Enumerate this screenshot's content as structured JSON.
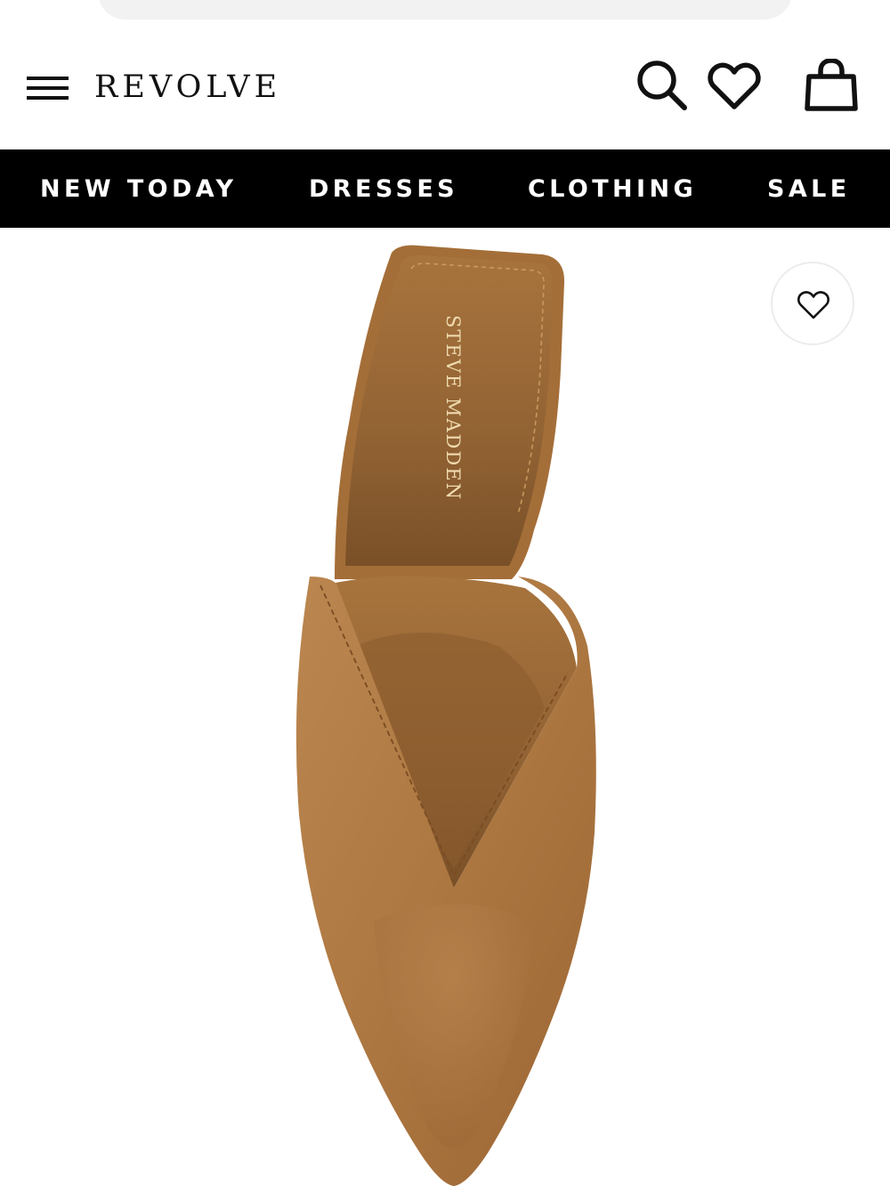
{
  "header": {
    "logo": "REVOLVE",
    "menu_icon": "hamburger-menu-icon",
    "search_icon": "search-icon",
    "wishlist_icon": "heart-icon",
    "bag_icon": "shopping-bag-icon"
  },
  "nav": {
    "items": [
      {
        "label": "NEW TODAY"
      },
      {
        "label": "DRESSES"
      },
      {
        "label": "CLOTHING"
      },
      {
        "label": "SALE"
      }
    ]
  },
  "product": {
    "insole_brand": "STEVE MADDEN",
    "wishlist_icon": "heart-outline-icon"
  },
  "colors": {
    "nav_background": "#000000",
    "nav_text": "#ffffff",
    "suede": "#b07a45",
    "insole": "#9a6a38"
  }
}
